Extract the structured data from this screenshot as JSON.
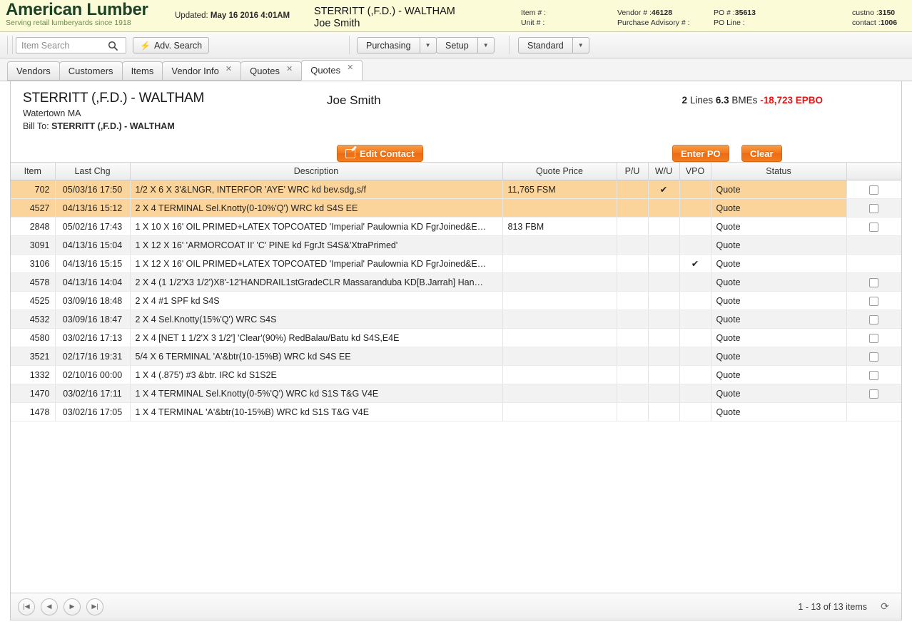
{
  "banner": {
    "brand_title": "American Lumber",
    "brand_tagline": "Serving retail lumberyards since 1918",
    "updated_label": "Updated:",
    "updated_value": "May 16 2016 4:01AM",
    "customer_name": "STERRITT (,F.D.) - WALTHAM",
    "contact_name": "Joe Smith",
    "meta": {
      "item_label": "Item # :",
      "item_value": "",
      "unit_label": "Unit # :",
      "unit_value": "",
      "vendor_label": "Vendor # :",
      "vendor_value": "46128",
      "advisory_label": "Purchase Advisory # :",
      "advisory_value": "",
      "po_label": "PO # :",
      "po_value": "35613",
      "poline_label": "PO Line :",
      "poline_value": "",
      "custno_label": "custno :",
      "custno_value": "3150",
      "contact_label": "contact :",
      "contact_value": "1006"
    }
  },
  "toolbar": {
    "search_placeholder": "Item Search",
    "search_value": "",
    "search_icon": "search-icon",
    "adv_search_label": "Adv. Search",
    "adv_search_icon": "bolt-icon",
    "purchasing_label": "Purchasing",
    "setup_label": "Setup",
    "standard_label": "Standard",
    "dropdown_icon": "chevron-down-icon"
  },
  "tabs": [
    {
      "label": "Vendors",
      "closable": false,
      "active": false
    },
    {
      "label": "Customers",
      "closable": false,
      "active": false
    },
    {
      "label": "Items",
      "closable": false,
      "active": false
    },
    {
      "label": "Vendor Info",
      "closable": true,
      "active": false
    },
    {
      "label": "Quotes",
      "closable": true,
      "active": false
    },
    {
      "label": "Quotes",
      "closable": true,
      "active": true
    }
  ],
  "tab_close_glyph": "✕",
  "panel": {
    "account_name": "STERRITT (,F.D.) - WALTHAM",
    "city_state": "Watertown MA",
    "bill_to_label": "Bill To:",
    "bill_to_value": "STERRITT (,F.D.) - WALTHAM",
    "contact_name": "Joe Smith",
    "summary": {
      "lines_value": "2",
      "lines_label": "Lines",
      "bmes_value": "6.3",
      "bmes_label": "BMEs",
      "epbo_text": "-18,723 EPBO",
      "epbo_color": "#e81313"
    },
    "edit_contact_label": "Edit Contact",
    "edit_contact_icon": "edit-pencil-icon",
    "enter_po_label": "Enter PO",
    "clear_label": "Clear",
    "accent_color": "#f4751c",
    "highlight_color": "#fad49a"
  },
  "grid": {
    "columns": [
      "Item",
      "Last Chg",
      "Description",
      "Quote Price",
      "P/U",
      "W/U",
      "VPO",
      "Status",
      ""
    ],
    "check_glyph": "✔",
    "rows": [
      {
        "item": "702",
        "last_chg": "05/03/16 17:50",
        "description": "1/2 X 6 X 3'&LNGR, INTERFOR 'AYE' WRC kd bev.sdg,s/f",
        "quote_price": "11,765 FSM",
        "pu": "",
        "wu": "✔",
        "vpo": "",
        "status": "Quote",
        "checkbox": true,
        "highlight": true,
        "alt": false
      },
      {
        "item": "4527",
        "last_chg": "04/13/16 15:12",
        "description": "2 X 4 TERMINAL Sel.Knotty(0-10%'Q') WRC kd S4S EE",
        "quote_price": "",
        "pu": "",
        "wu": "",
        "vpo": "",
        "status": "Quote",
        "checkbox": true,
        "highlight": true,
        "alt": true
      },
      {
        "item": "2848",
        "last_chg": "05/02/16 17:43",
        "description": "1 X 10 X 16' OIL PRIMED+LATEX TOPCOATED 'Imperial' Paulownia KD FgrJoined&E…",
        "quote_price": "813 FBM",
        "pu": "",
        "wu": "",
        "vpo": "",
        "status": "Quote",
        "checkbox": true,
        "highlight": false,
        "alt": false
      },
      {
        "item": "3091",
        "last_chg": "04/13/16 15:04",
        "description": "1 X 12 X 16' 'ARMORCOAT II' 'C' PINE kd FgrJt S4S&'XtraPrimed'",
        "quote_price": "",
        "pu": "",
        "wu": "",
        "vpo": "",
        "status": "Quote",
        "checkbox": false,
        "highlight": false,
        "alt": true
      },
      {
        "item": "3106",
        "last_chg": "04/13/16 15:15",
        "description": "1 X 12 X 16' OIL PRIMED+LATEX TOPCOATED 'Imperial' Paulownia KD FgrJoined&E…",
        "quote_price": "",
        "pu": "",
        "wu": "",
        "vpo": "✔",
        "status": "Quote",
        "checkbox": false,
        "highlight": false,
        "alt": false
      },
      {
        "item": "4578",
        "last_chg": "04/13/16 14:04",
        "description": "2 X 4 (1 1/2'X3 1/2')X8'-12'HANDRAIL1stGradeCLR Massaranduba KD[B.Jarrah] Han…",
        "quote_price": "",
        "pu": "",
        "wu": "",
        "vpo": "",
        "status": "Quote",
        "checkbox": true,
        "highlight": false,
        "alt": true
      },
      {
        "item": "4525",
        "last_chg": "03/09/16 18:48",
        "description": "2 X 4 #1 SPF kd S4S",
        "quote_price": "",
        "pu": "",
        "wu": "",
        "vpo": "",
        "status": "Quote",
        "checkbox": true,
        "highlight": false,
        "alt": false
      },
      {
        "item": "4532",
        "last_chg": "03/09/16 18:47",
        "description": "2 X 4 Sel.Knotty(15%'Q') WRC S4S",
        "quote_price": "",
        "pu": "",
        "wu": "",
        "vpo": "",
        "status": "Quote",
        "checkbox": true,
        "highlight": false,
        "alt": true
      },
      {
        "item": "4580",
        "last_chg": "03/02/16 17:13",
        "description": "2 X 4 [NET 1 1/2'X 3 1/2'] 'Clear'(90%) RedBalau/Batu kd S4S,E4E",
        "quote_price": "",
        "pu": "",
        "wu": "",
        "vpo": "",
        "status": "Quote",
        "checkbox": true,
        "highlight": false,
        "alt": false
      },
      {
        "item": "3521",
        "last_chg": "02/17/16 19:31",
        "description": "5/4 X 6 TERMINAL 'A'&btr(10-15%B) WRC kd S4S EE",
        "quote_price": "",
        "pu": "",
        "wu": "",
        "vpo": "",
        "status": "Quote",
        "checkbox": true,
        "highlight": false,
        "alt": true
      },
      {
        "item": "1332",
        "last_chg": "02/10/16 00:00",
        "description": "1 X 4 (.875') #3 &btr. IRC kd S1S2E",
        "quote_price": "",
        "pu": "",
        "wu": "",
        "vpo": "",
        "status": "Quote",
        "checkbox": true,
        "highlight": false,
        "alt": false
      },
      {
        "item": "1470",
        "last_chg": "03/02/16 17:11",
        "description": "1 X 4 TERMINAL Sel.Knotty(0-5%'Q') WRC kd S1S T&G V4E",
        "quote_price": "",
        "pu": "",
        "wu": "",
        "vpo": "",
        "status": "Quote",
        "checkbox": true,
        "highlight": false,
        "alt": true
      },
      {
        "item": "1478",
        "last_chg": "03/02/16 17:05",
        "description": "1 X 4 TERMINAL 'A'&btr(10-15%B) WRC kd S1S T&G V4E",
        "quote_price": "",
        "pu": "",
        "wu": "",
        "vpo": "",
        "status": "Quote",
        "checkbox": false,
        "highlight": false,
        "alt": false
      }
    ]
  },
  "pager": {
    "first_icon": "first-page-icon",
    "prev_icon": "prev-page-icon",
    "next_icon": "next-page-icon",
    "last_icon": "last-page-icon",
    "info": "1 - 13 of 13 items",
    "refresh_icon": "refresh-icon"
  }
}
